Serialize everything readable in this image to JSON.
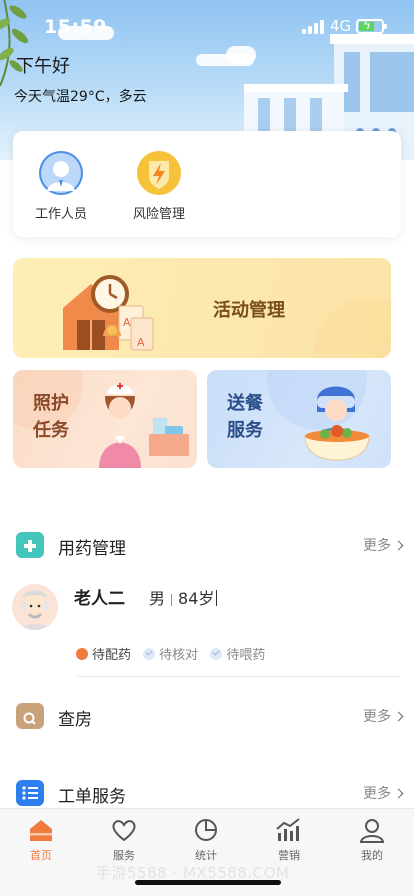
{
  "status_bar": {
    "time": "15:59",
    "network": "4G"
  },
  "header": {
    "greeting": "下午好",
    "weather": "今天气温29°C，多云"
  },
  "quick_actions": [
    {
      "label": "工作人员",
      "icon": "staff-icon"
    },
    {
      "label": "风险管理",
      "icon": "lightning-shield-icon"
    }
  ],
  "feature_tiles": {
    "activity": "活动管理",
    "care_task_line1": "照护",
    "care_task_line2": "任务",
    "meal_line1": "送餐",
    "meal_line2": "服务"
  },
  "medication_section": {
    "title": "用药管理",
    "more": "更多",
    "resident": {
      "name": "老人二",
      "gender": "男",
      "age": "84岁",
      "tags": [
        {
          "label": "待配药",
          "state": "active"
        },
        {
          "label": "待核对",
          "state": "inactive"
        },
        {
          "label": "待喂药",
          "state": "inactive"
        }
      ]
    }
  },
  "rounds_section": {
    "title": "查房",
    "more": "更多"
  },
  "workorder_section": {
    "title": "工单服务",
    "more": "更多"
  },
  "tabbar": {
    "active": "首页",
    "items": [
      {
        "label": "首页",
        "icon": "home-icon"
      },
      {
        "label": "服务",
        "icon": "heart-icon"
      },
      {
        "label": "统计",
        "icon": "pie-chart-icon"
      },
      {
        "label": "营销",
        "icon": "trend-chart-icon"
      },
      {
        "label": "我的",
        "icon": "user-icon"
      }
    ]
  },
  "watermark": "手游5588 · MX5588.COM",
  "colors": {
    "accent": "#f07b3f",
    "activity_text": "#7a4e1a",
    "care_text": "#8c4a28",
    "meal_text": "#2a4e8a"
  }
}
